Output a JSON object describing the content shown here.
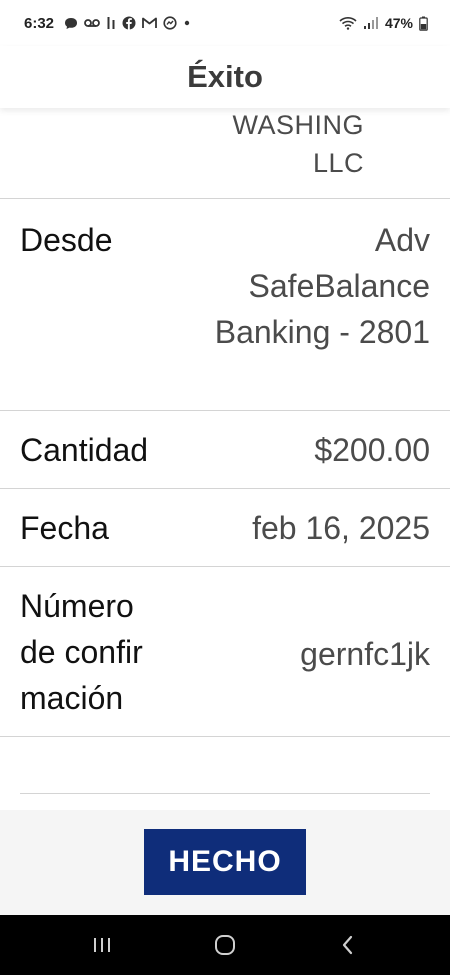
{
  "status_bar": {
    "time": "6:32",
    "battery": "47%",
    "notification_icons": [
      "chat-icon",
      "voicemail-icon",
      "sim-icon",
      "facebook-icon",
      "gmail-icon",
      "messenger-icon",
      "dot-icon"
    ]
  },
  "header": {
    "title": "Éxito"
  },
  "payee": {
    "line1": "WASHING",
    "line2": "LLC"
  },
  "details": {
    "from": {
      "label": "Desde",
      "value_line1": "Adv",
      "value_line2": "SafeBalance",
      "value_line3": "Banking - 2801"
    },
    "amount": {
      "label": "Cantidad",
      "value": "$200.00"
    },
    "date": {
      "label": "Fecha",
      "value": "feb 16, 2025"
    },
    "confirmation": {
      "label_line1": "Número",
      "label_line2": "de confir",
      "label_line3": "mación",
      "value": "gernfc1jk"
    }
  },
  "actions": {
    "done_label": "HECHO"
  },
  "colors": {
    "button_bg": "#0f2d7a",
    "divider": "#d4d4d4",
    "nav_bar": "#000000"
  }
}
